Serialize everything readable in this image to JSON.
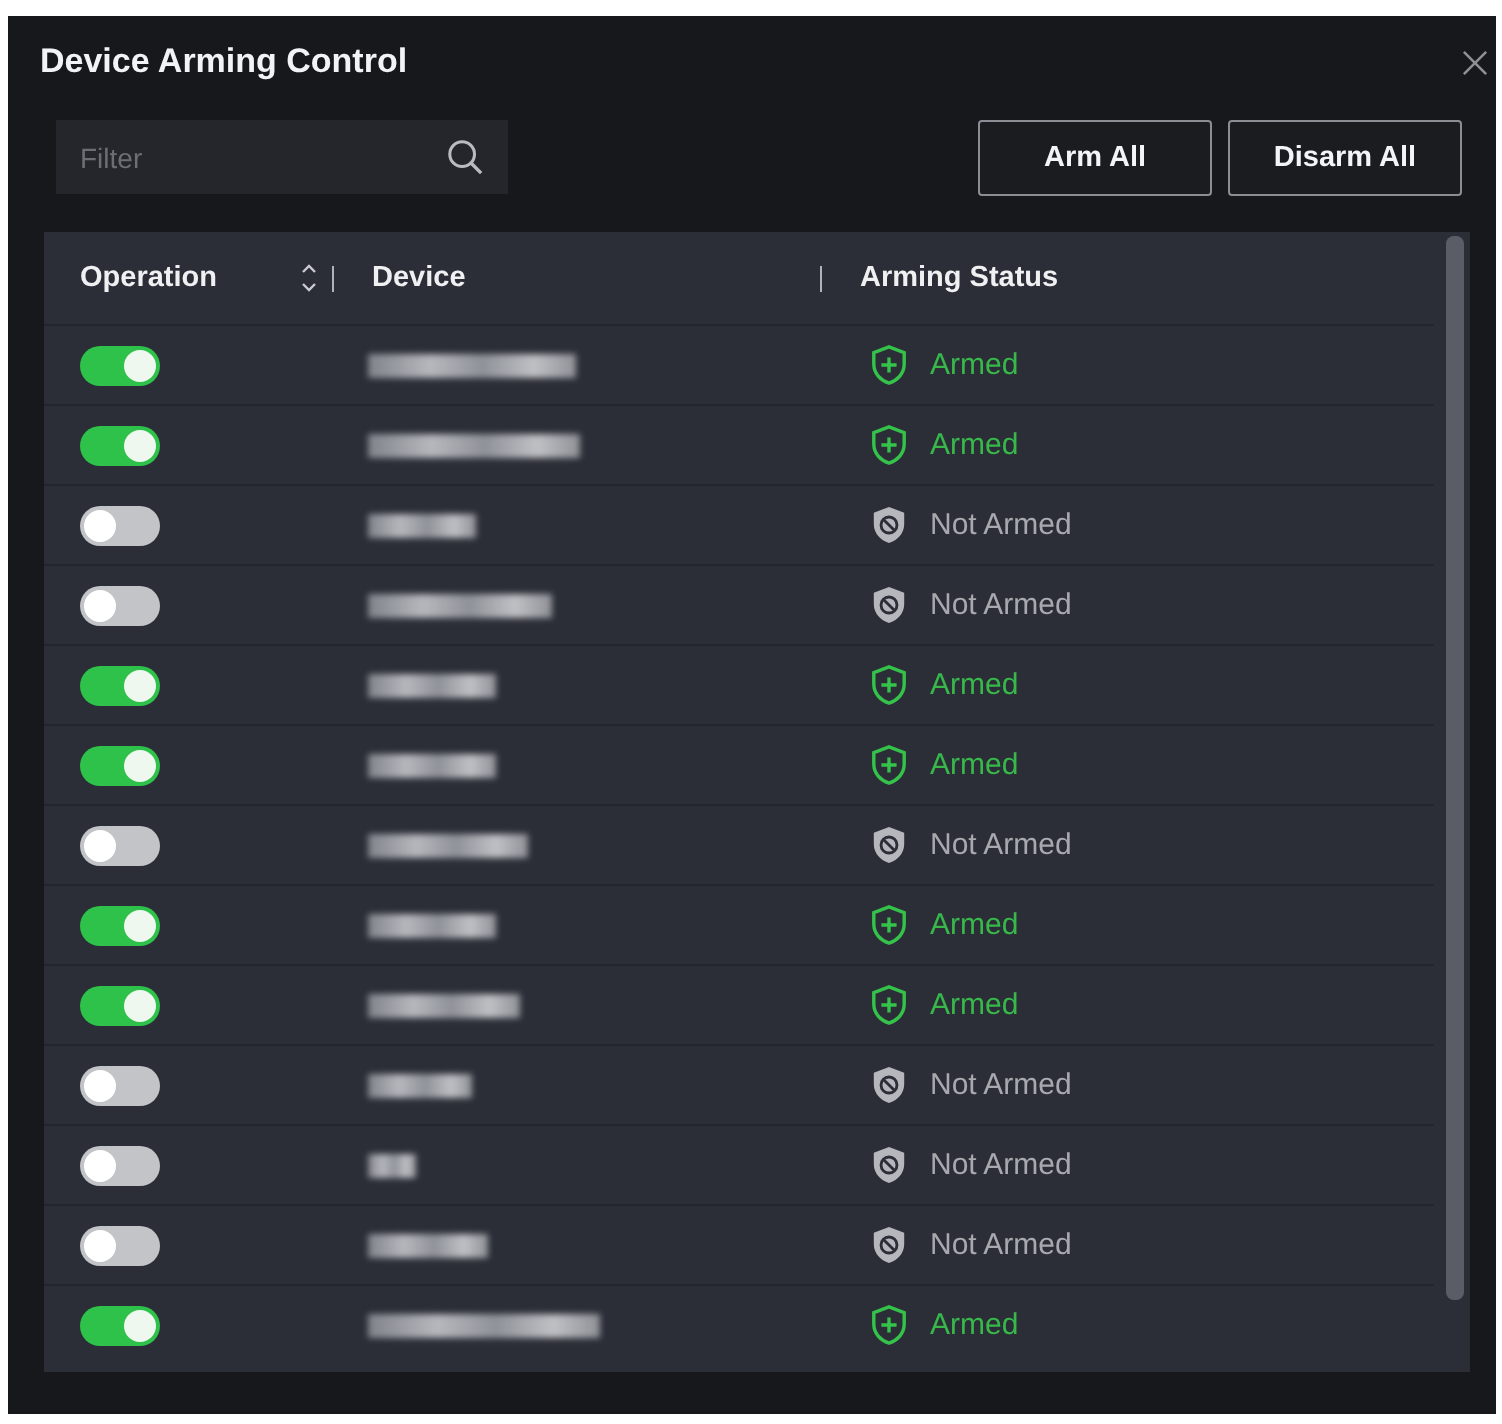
{
  "dialog": {
    "title": "Device Arming Control"
  },
  "filter": {
    "placeholder": "Filter"
  },
  "buttons": [
    {
      "label": "Arm All"
    },
    {
      "label": "Disarm All"
    }
  ],
  "table": {
    "columns": [
      {
        "label": "Operation",
        "sortable": true
      },
      {
        "label": "Device"
      },
      {
        "label": "Arming Status"
      }
    ],
    "rows": [
      {
        "switch_on": true,
        "status": "Armed",
        "armed": true
      },
      {
        "switch_on": true,
        "status": "Armed",
        "armed": true
      },
      {
        "switch_on": false,
        "status": "Not Armed",
        "armed": false
      },
      {
        "switch_on": false,
        "status": "Not Armed",
        "armed": false
      },
      {
        "switch_on": true,
        "status": "Armed",
        "armed": true
      },
      {
        "switch_on": true,
        "status": "Armed",
        "armed": true
      },
      {
        "switch_on": false,
        "status": "Not Armed",
        "armed": false
      },
      {
        "switch_on": true,
        "status": "Armed",
        "armed": true
      },
      {
        "switch_on": true,
        "status": "Armed",
        "armed": true
      },
      {
        "switch_on": false,
        "status": "Not Armed",
        "armed": false
      },
      {
        "switch_on": false,
        "status": "Not Armed",
        "armed": false
      },
      {
        "switch_on": false,
        "status": "Not Armed",
        "armed": false
      },
      {
        "switch_on": true,
        "status": "Armed",
        "armed": true
      }
    ]
  }
}
